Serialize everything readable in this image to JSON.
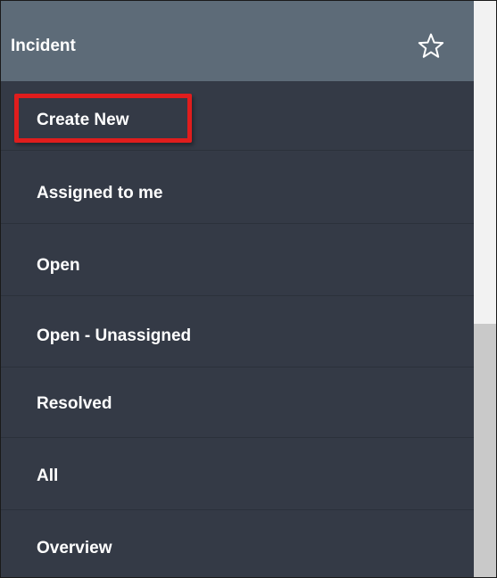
{
  "header": {
    "title": "Incident",
    "favorite_icon": "star-outline-icon"
  },
  "menu": {
    "items": [
      {
        "label": "Create New",
        "highlighted": true
      },
      {
        "label": "Assigned to me"
      },
      {
        "label": "Open"
      },
      {
        "label": "Open - Unassigned"
      },
      {
        "label": "Resolved"
      },
      {
        "label": "All"
      },
      {
        "label": "Overview"
      }
    ]
  },
  "colors": {
    "nav_background": "#343a46",
    "header_background": "#5d6b78",
    "highlight_border": "#e01d1d",
    "text": "#ffffff"
  }
}
